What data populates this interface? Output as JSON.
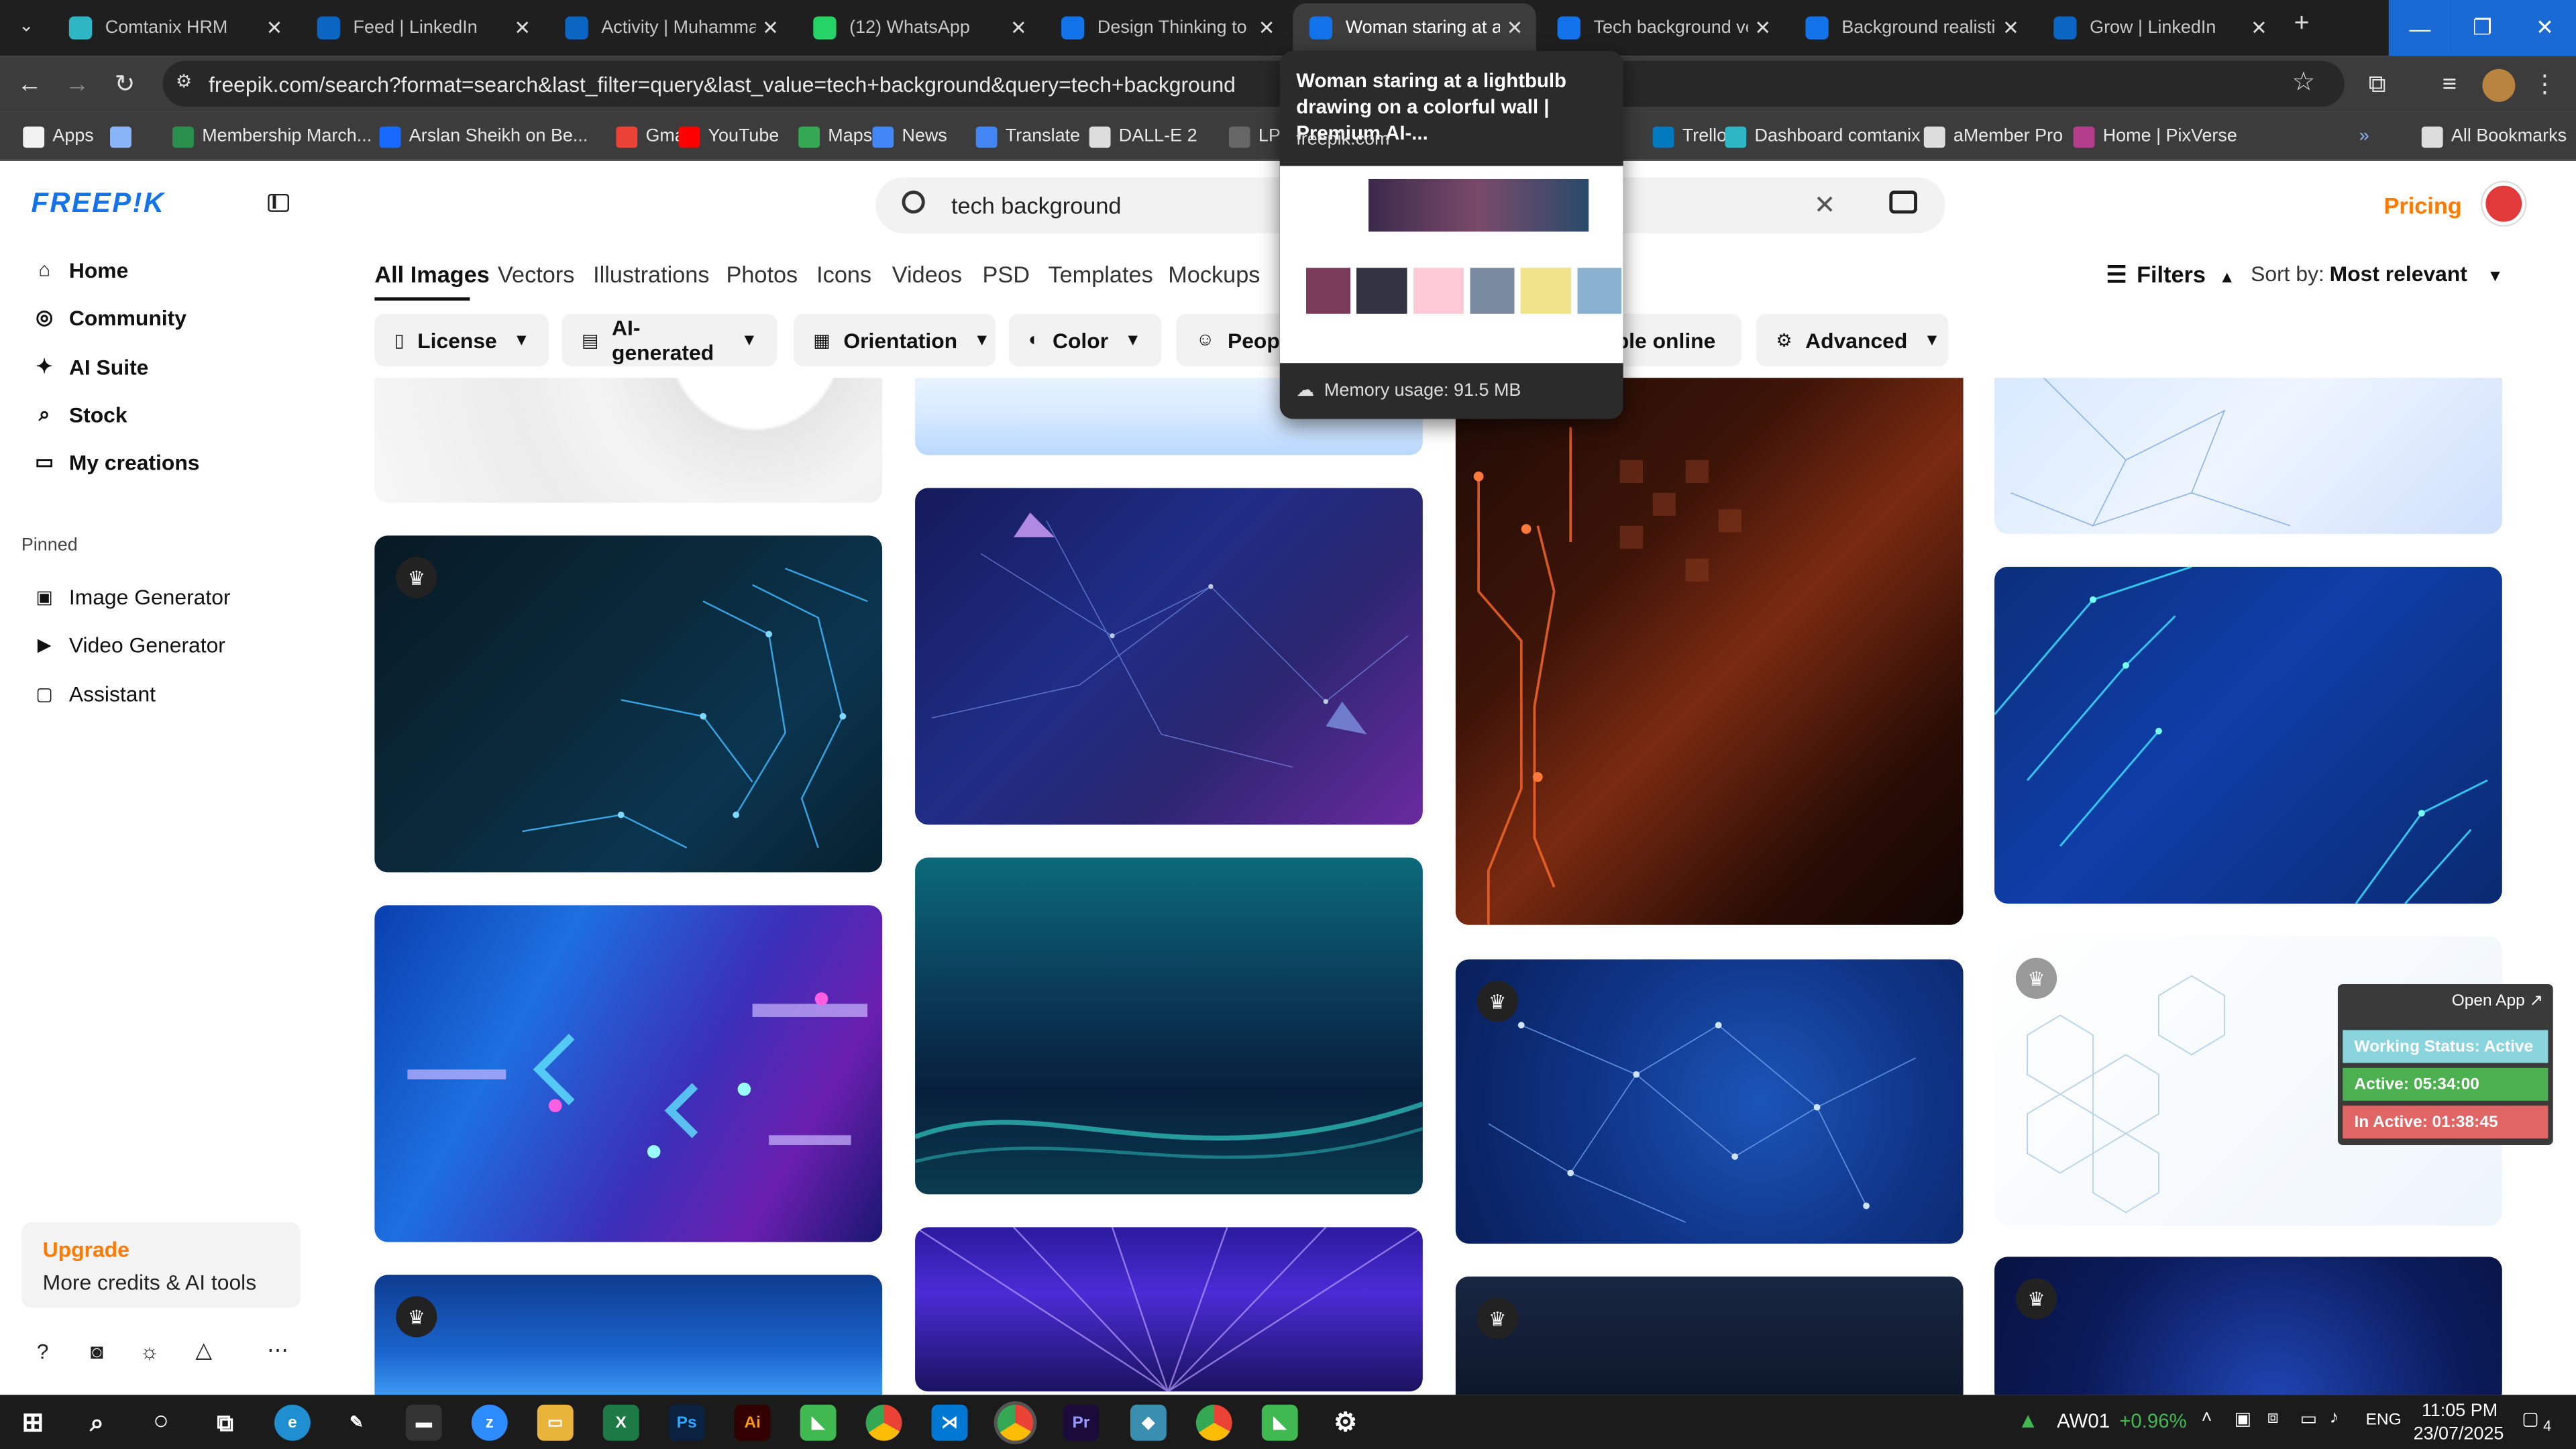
{
  "browser": {
    "tabs": [
      {
        "title": "Comtanix HRM",
        "icon": "comtanix-icon",
        "color": "#2fb6c4"
      },
      {
        "title": "Feed | LinkedIn",
        "icon": "linkedin-icon",
        "color": "#0a66c2"
      },
      {
        "title": "Activity | Muhammad",
        "icon": "linkedin-icon",
        "color": "#0a66c2"
      },
      {
        "title": "(12) WhatsApp",
        "icon": "whatsapp-icon",
        "color": "#25d366"
      },
      {
        "title": "Design Thinking to C",
        "icon": "freepik-icon",
        "color": "#1273eb"
      },
      {
        "title": "Woman staring at a l",
        "icon": "freepik-icon",
        "color": "#1273eb"
      },
      {
        "title": "Tech background vec",
        "icon": "freepik-icon",
        "color": "#1273eb"
      },
      {
        "title": "Background realistic",
        "icon": "freepik-icon",
        "color": "#1273eb"
      },
      {
        "title": "Grow | LinkedIn",
        "icon": "linkedin-icon",
        "color": "#0a66c2"
      }
    ],
    "url": "freepik.com/search?format=search&last_filter=query&last_value=tech+background&query=tech+background",
    "bookmarks": [
      {
        "label": "Apps",
        "icon": "apps-grid-icon"
      },
      {
        "label": "",
        "icon": "grid-icon"
      },
      {
        "label": "Membership March...",
        "icon": "bookmark-icon"
      },
      {
        "label": "Arslan Sheikh on Be...",
        "icon": "behance-icon"
      },
      {
        "label": "Gmail",
        "icon": "gmail-icon"
      },
      {
        "label": "YouTube",
        "icon": "youtube-icon"
      },
      {
        "label": "Maps",
        "icon": "maps-icon"
      },
      {
        "label": "News",
        "icon": "news-icon"
      },
      {
        "label": "Translate",
        "icon": "translate-icon"
      },
      {
        "label": "DALL-E 2",
        "icon": "openai-icon"
      },
      {
        "label": "LPX AG",
        "icon": "bookmark-icon"
      },
      {
        "label": "Trello",
        "icon": "trello-icon"
      },
      {
        "label": "Dashboard comtanix",
        "icon": "comtanix-icon"
      },
      {
        "label": "aMember Pro",
        "icon": "amember-icon"
      },
      {
        "label": "Home | PixVerse",
        "icon": "pixverse-icon"
      },
      {
        "label": "All Bookmarks",
        "icon": "folder-icon"
      }
    ]
  },
  "sidebar": {
    "logo": "FREEP!K",
    "nav": [
      {
        "label": "Home",
        "icon": "home-icon"
      },
      {
        "label": "Community",
        "icon": "globe-icon"
      },
      {
        "label": "AI Suite",
        "icon": "sparkle-icon"
      },
      {
        "label": "Stock",
        "icon": "search-icon"
      },
      {
        "label": "My creations",
        "icon": "folder-icon"
      }
    ],
    "pinned_label": "Pinned",
    "pinned": [
      {
        "label": "Image Generator",
        "icon": "image-icon"
      },
      {
        "label": "Video Generator",
        "icon": "video-icon"
      },
      {
        "label": "Assistant",
        "icon": "chat-icon"
      }
    ],
    "upgrade": {
      "title": "Upgrade",
      "subtitle": "More credits & AI tools"
    }
  },
  "header": {
    "search_query": "tech background",
    "pricing": "Pricing"
  },
  "categories": [
    "All Images",
    "Vectors",
    "Illustrations",
    "Photos",
    "Icons",
    "Videos",
    "PSD",
    "Templates",
    "Mockups"
  ],
  "filters_label": "Filters",
  "sort": {
    "label": "Sort by:",
    "value": "Most relevant"
  },
  "chips": [
    {
      "label": "License",
      "icon": "license-icon"
    },
    {
      "label": "AI-generated",
      "icon": "ai-icon"
    },
    {
      "label": "Orientation",
      "icon": "orientation-icon"
    },
    {
      "label": "Color",
      "icon": "palette-icon"
    },
    {
      "label": "People",
      "icon": "people-icon"
    },
    {
      "label": "table online",
      "icon": ""
    },
    {
      "label": "Advanced",
      "icon": "gear-icon"
    }
  ],
  "hover_card": {
    "title": "Woman staring at a lightbulb drawing on a colorful wall | Premium AI-...",
    "domain": "freepik.com",
    "memory": "Memory usage: 91.5 MB"
  },
  "tracker": {
    "open_app": "Open App",
    "status": "Working Status: Active",
    "active": "Active: 05:34:00",
    "inactive": "In Active: 01:38:45",
    "colors": {
      "status": "#8ad4dd",
      "active": "#4caf50",
      "inactive": "#e06666"
    }
  },
  "taskbar": {
    "stock_symbol": "AW01",
    "stock_change": "+0.96%",
    "lang": "ENG",
    "time": "11:05 PM",
    "date": "23/07/2025",
    "notifications": "4"
  },
  "colors": {
    "accent": "#1273eb",
    "upgrade": "#ff7a00"
  }
}
